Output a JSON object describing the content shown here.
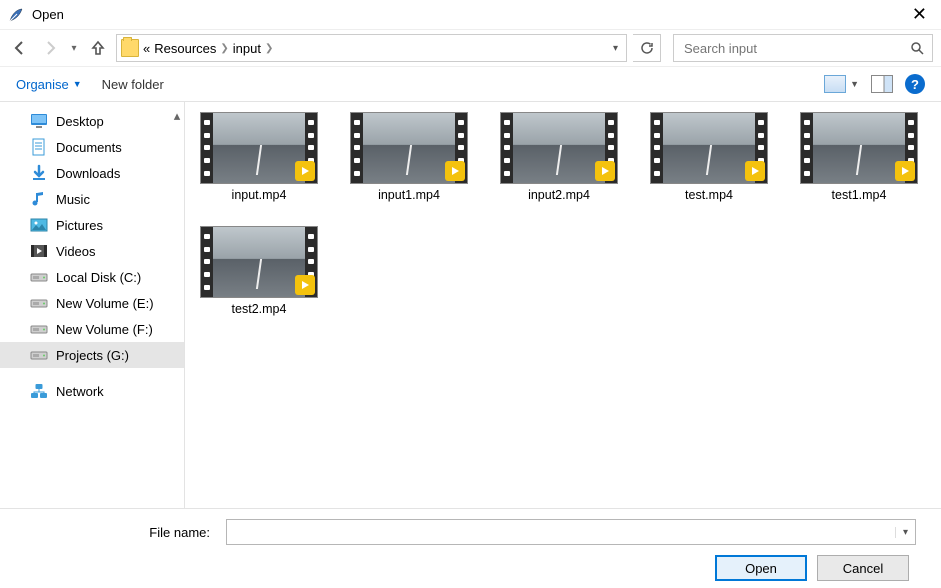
{
  "window": {
    "title": "Open"
  },
  "breadcrumb": {
    "prefix": "«",
    "items": [
      "Resources",
      "input"
    ]
  },
  "search": {
    "placeholder": "Search input"
  },
  "toolbar": {
    "organise": "Organise",
    "newfolder": "New folder"
  },
  "sidebar": {
    "items": [
      {
        "id": "desktop",
        "label": "Desktop",
        "icon": "desktop"
      },
      {
        "id": "documents",
        "label": "Documents",
        "icon": "doc"
      },
      {
        "id": "downloads",
        "label": "Downloads",
        "icon": "down"
      },
      {
        "id": "music",
        "label": "Music",
        "icon": "music"
      },
      {
        "id": "pictures",
        "label": "Pictures",
        "icon": "pic"
      },
      {
        "id": "videos",
        "label": "Videos",
        "icon": "vid"
      },
      {
        "id": "cdrive",
        "label": "Local Disk (C:)",
        "icon": "disk"
      },
      {
        "id": "edrive",
        "label": "New Volume (E:)",
        "icon": "disk"
      },
      {
        "id": "fdrive",
        "label": "New Volume (F:)",
        "icon": "disk"
      },
      {
        "id": "gdrive",
        "label": "Projects (G:)",
        "icon": "disk",
        "selected": true
      }
    ],
    "network": {
      "label": "Network"
    }
  },
  "files": [
    {
      "name": "input.mp4"
    },
    {
      "name": "input1.mp4"
    },
    {
      "name": "input2.mp4"
    },
    {
      "name": "test.mp4"
    },
    {
      "name": "test1.mp4"
    },
    {
      "name": "test2.mp4"
    }
  ],
  "footer": {
    "filename_label": "File name:",
    "filename_value": "",
    "open": "Open",
    "cancel": "Cancel"
  }
}
